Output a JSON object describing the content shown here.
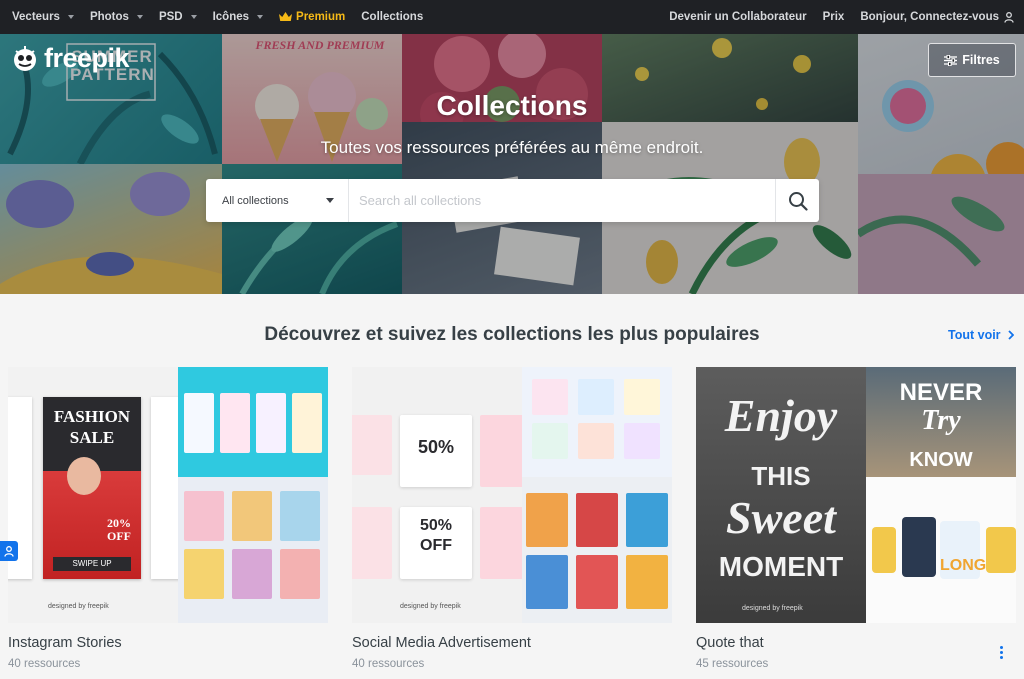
{
  "nav": {
    "left_items": [
      {
        "label": "Vecteurs",
        "dropdown": true
      },
      {
        "label": "Photos",
        "dropdown": true
      },
      {
        "label": "PSD",
        "dropdown": true
      },
      {
        "label": "Icônes",
        "dropdown": true
      }
    ],
    "premium_label": "Premium",
    "collections_label": "Collections",
    "right_items": {
      "contributor": "Devenir un Collaborateur",
      "pricing": "Prix",
      "login": "Bonjour, Connectez-vous"
    }
  },
  "hero": {
    "logo_text": "freepik",
    "filters_label": "Filtres",
    "title": "Collections",
    "subtitle": "Toutes vos ressources préférées au même endroit.",
    "search": {
      "scope_value": "All collections",
      "placeholder": "Search all collections"
    }
  },
  "section": {
    "title": "Découvrez et suivez les collections les plus populaires",
    "see_all": "Tout voir"
  },
  "collections": [
    {
      "name": "Instagram Stories",
      "count": "40 ressources"
    },
    {
      "name": "Social Media Advertisement",
      "count": "40 ressources"
    },
    {
      "name": "Quote that",
      "count": "45 ressources"
    }
  ],
  "thumb_text": {
    "fashion": "FASHION",
    "sale": "SALE",
    "off": "20% OFF",
    "swipe": "SWIPE UP",
    "fifty": "50%",
    "fifty_off": "OFF",
    "enjoy": "Enjoy",
    "this": "THIS",
    "sweet": "Sweet",
    "moment": "MOMENT",
    "never": "NEVER",
    "try": "Try",
    "know": "KNOW",
    "road": "LONG",
    "designed": "designed by freepik",
    "summer": "SUMMER PATTERN",
    "fresh": "FRESH AND PREMIUM"
  },
  "colors": {
    "nav_bg": "#1f2125",
    "premium": "#f5b917",
    "accent": "#1273eb"
  }
}
